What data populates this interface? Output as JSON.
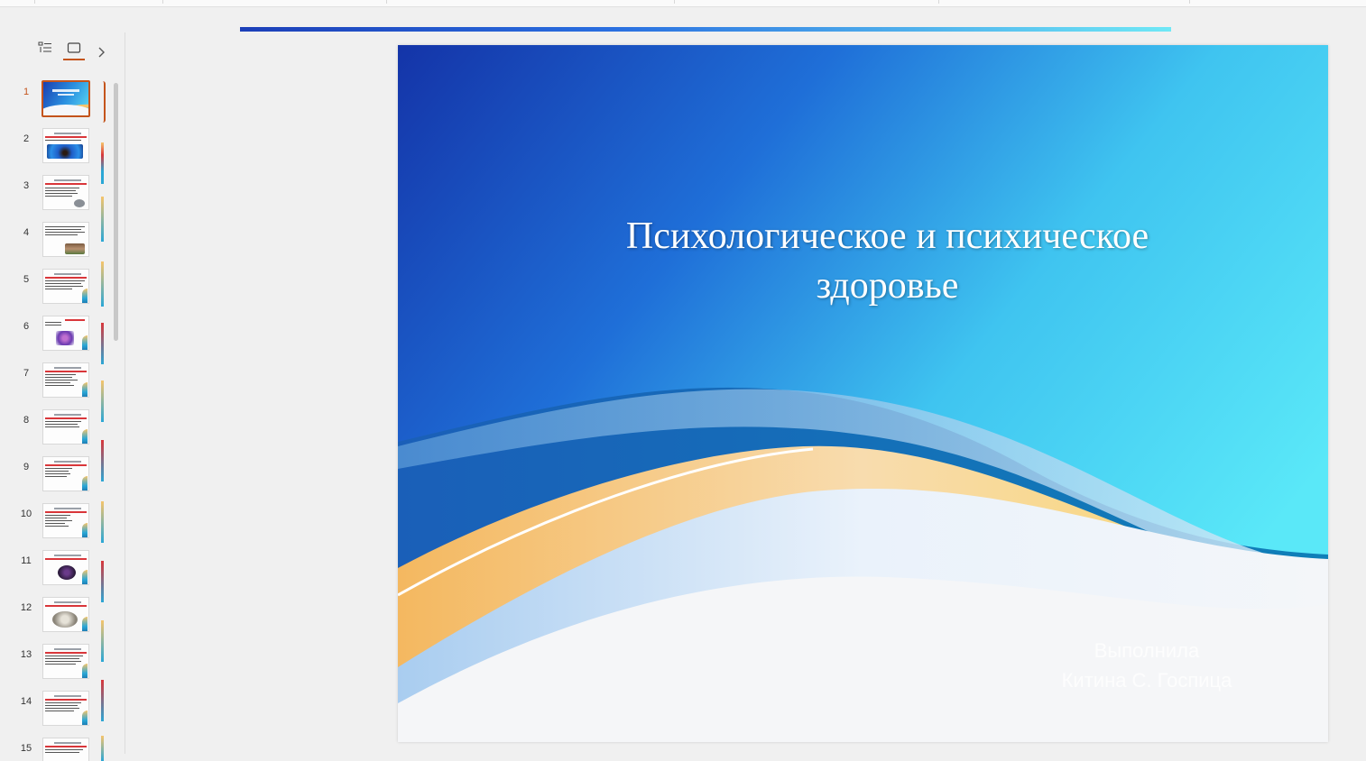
{
  "left_panel": {
    "outline_view_icon": "list-outline-icon",
    "slide_view_icon": "slide-thumbnail-icon",
    "collapse_icon": "chevron-right-icon",
    "slides": [
      {
        "number": "1",
        "selected": true
      },
      {
        "number": "2"
      },
      {
        "number": "3"
      },
      {
        "number": "4"
      },
      {
        "number": "5"
      },
      {
        "number": "6"
      },
      {
        "number": "7"
      },
      {
        "number": "8"
      },
      {
        "number": "9"
      },
      {
        "number": "10"
      },
      {
        "number": "11"
      },
      {
        "number": "12"
      },
      {
        "number": "13"
      },
      {
        "number": "14"
      },
      {
        "number": "15"
      }
    ]
  },
  "slide": {
    "title": "Психологическое и психическое здоровье",
    "subtitle_line1": "Выполнила",
    "subtitle_line2": "Китина С. Госпица"
  },
  "colors": {
    "accent": "#c4541c",
    "slide_blue_dark": "#1a3fb0",
    "slide_cyan": "#4fe6f8",
    "wave_yellow": "#f5c46b"
  }
}
